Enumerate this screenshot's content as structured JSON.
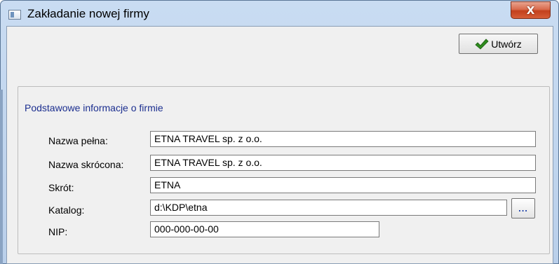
{
  "window": {
    "title": "Zakładanie nowej firmy"
  },
  "title_bar": {
    "close_glyph": "X"
  },
  "toolbar": {
    "create_label": "Utwórz",
    "create_icon": "checkmark-icon",
    "check_color": "#2e8b1e"
  },
  "group": {
    "title": "Podstawowe informacje o firmie",
    "fields": {
      "full_name": {
        "label": "Nazwa pełna:",
        "value": "ETNA TRAVEL sp. z o.o."
      },
      "short_name": {
        "label": "Nazwa skrócona:",
        "value": "ETNA TRAVEL sp. z o.o."
      },
      "abbrev": {
        "label": "Skrót:",
        "value": "ETNA"
      },
      "catalog": {
        "label": "Katalog:",
        "value": "d:\\KDP\\etna",
        "browse_label": "..."
      },
      "nip": {
        "label": "NIP:",
        "value": "000-000-00-00"
      }
    }
  },
  "colors": {
    "group_title": "#1b2e8f",
    "close_button": "#c3401d",
    "frame": "#b9cfea"
  }
}
